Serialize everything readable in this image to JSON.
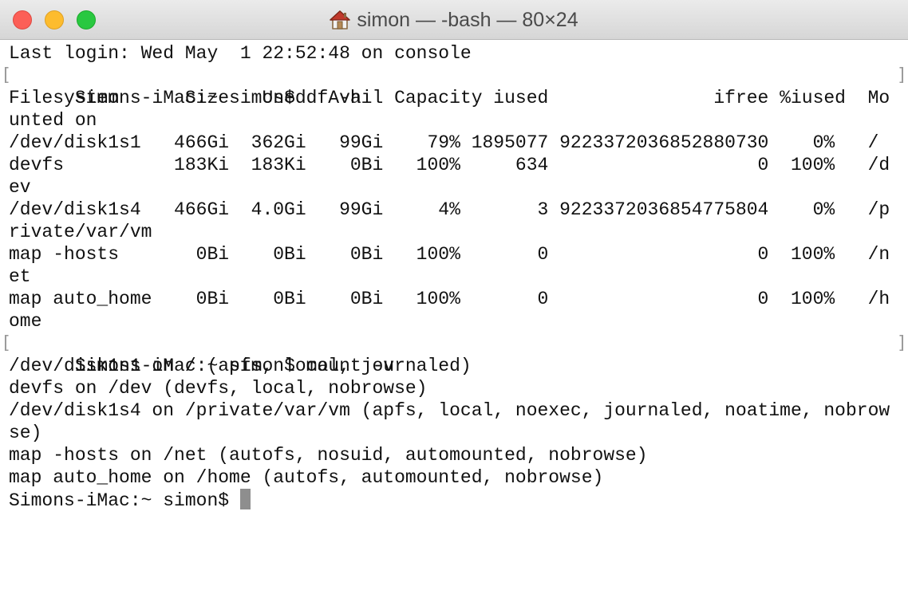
{
  "window": {
    "title": "simon — -bash — 80×24",
    "title_icon": "home-icon",
    "buttons": [
      {
        "name": "close",
        "color": "#fc5f57"
      },
      {
        "name": "minimize",
        "color": "#fdbc2e"
      },
      {
        "name": "zoom",
        "color": "#29c840"
      }
    ]
  },
  "terminal": {
    "lines": [
      "Last login: Wed May  1 22:52:48 on console",
      "Simons-iMac:~ simon$ df -h",
      "Filesystem      Size   Used  Avail Capacity iused               ifree %iused  Mo",
      "unted on",
      "/dev/disk1s1   466Gi  362Gi   99Gi    79% 1895077 9223372036852880730    0%   /",
      "devfs          183Ki  183Ki    0Bi   100%     634                   0  100%   /d",
      "ev",
      "/dev/disk1s4   466Gi  4.0Gi   99Gi     4%       3 9223372036854775804    0%   /p",
      "rivate/var/vm",
      "map -hosts       0Bi    0Bi    0Bi   100%       0                   0  100%   /n",
      "et",
      "map auto_home    0Bi    0Bi    0Bi   100%       0                   0  100%   /h",
      "ome",
      "Simons-iMac:~ simon$ mount -v",
      "/dev/disk1s1 on / (apfs, local, journaled)",
      "devfs on /dev (devfs, local, nobrowse)",
      "/dev/disk1s4 on /private/var/vm (apfs, local, noexec, journaled, noatime, nobrow",
      "se)",
      "map -hosts on /net (autofs, nosuid, automounted, nobrowse)",
      "map auto_home on /home (autofs, automounted, nobrowse)"
    ],
    "prompt": "Simons-iMac:~ simon$ ",
    "cursor_color": "#8e8e8e"
  }
}
